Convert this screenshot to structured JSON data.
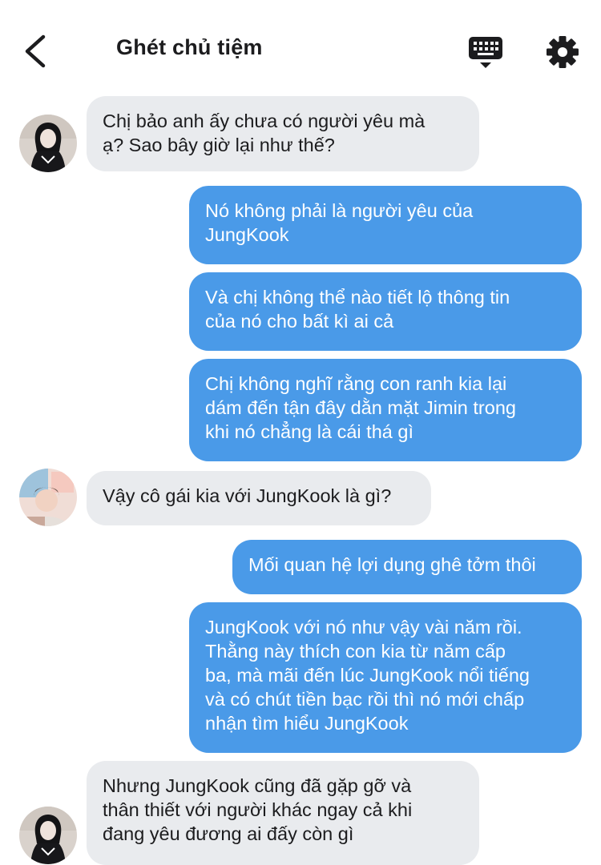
{
  "header": {
    "title": "Ghét chủ tiệm",
    "back_icon": "chevron-left-icon",
    "keyboard_icon": "keyboard-icon",
    "settings_icon": "gear-icon"
  },
  "colors": {
    "outgoing_bubble": "#4a9ae8",
    "incoming_bubble": "#e9ebee",
    "text_dark": "#1c1c1e"
  },
  "messages": [
    {
      "side": "in",
      "avatar": "girl-avatar",
      "text": "Chị bảo anh ấy chưa có người yêu mà\nạ? Sao bây giờ lại như thế?"
    },
    {
      "side": "out",
      "text": "Nó không phải là người yêu của\nJungKook"
    },
    {
      "side": "out",
      "text": "Và chị không thể nào tiết lộ thông tin\ncủa nó cho bất kì ai cả"
    },
    {
      "side": "out",
      "text": "Chị không nghĩ rằng con ranh kia lại\ndám đến tận đây dằn mặt Jimin trong\nkhi nó chẳng là cái thá gì"
    },
    {
      "side": "in",
      "avatar": "boy-avatar",
      "text": "Vậy cô gái kia với JungKook là gì?"
    },
    {
      "side": "out",
      "text": "Mối quan hệ lợi dụng ghê tởm thôi"
    },
    {
      "side": "out",
      "text": "JungKook với nó như vậy vài năm rồi.\nThằng này thích con kia từ năm cấp\nba, mà mãi đến lúc JungKook nổi tiếng\nvà có chút tiền bạc rồi thì nó mới chấp\nnhận tìm hiểu JungKook"
    },
    {
      "side": "in",
      "avatar": "girl-avatar",
      "text": "Nhưng JungKook cũng đã gặp gỡ và\nthân thiết với người khác ngay cả khi\nđang yêu đương ai đấy còn gì"
    }
  ]
}
